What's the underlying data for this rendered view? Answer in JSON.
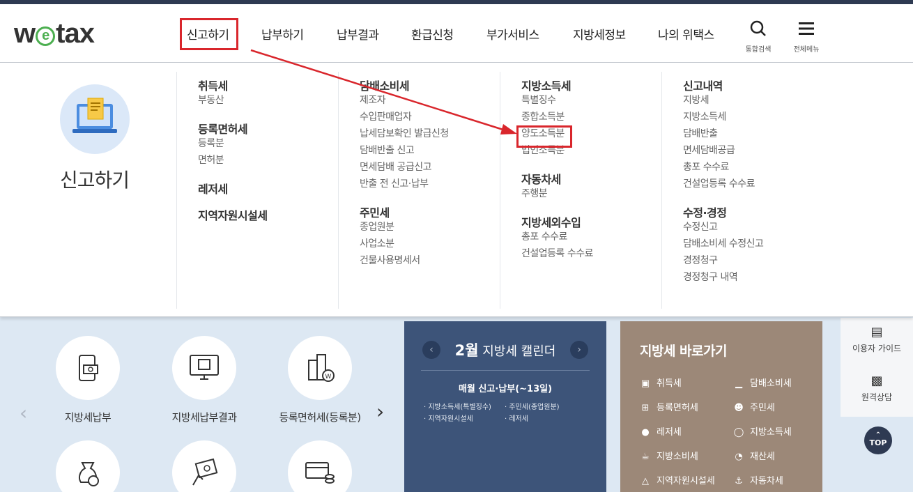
{
  "logo": {
    "text_left": "w",
    "text_e": "e",
    "text_right": "tax"
  },
  "gnb": {
    "items": [
      {
        "label": "신고하기"
      },
      {
        "label": "납부하기"
      },
      {
        "label": "납부결과"
      },
      {
        "label": "환급신청"
      },
      {
        "label": "부가서비스"
      },
      {
        "label": "지방세정보"
      },
      {
        "label": "나의 위택스"
      }
    ],
    "search_label": "통합검색",
    "menu_label": "전체메뉴"
  },
  "mega": {
    "intro_title": "신고하기",
    "col1": {
      "g1": {
        "title": "취득세",
        "items": [
          "부동산"
        ]
      },
      "g2": {
        "title": "등록면허세",
        "items": [
          "등록분",
          "면허분"
        ]
      },
      "g3": {
        "title": "레저세"
      },
      "g4": {
        "title": "지역자원시설세"
      }
    },
    "col2": {
      "g1": {
        "title": "담배소비세",
        "items": [
          "제조자",
          "수입판매업자",
          "납세담보확인 발급신청",
          "담배반출 신고",
          "면세담배 공급신고",
          "반출 전 신고·납부"
        ]
      },
      "g2": {
        "title": "주민세",
        "items": [
          "종업원분",
          "사업소분",
          "건물사용명세서"
        ]
      }
    },
    "col3": {
      "g1": {
        "title": "지방소득세",
        "items": [
          "특별징수",
          "종합소득분",
          "양도소득분",
          "법인소득분"
        ]
      },
      "g2": {
        "title": "자동차세",
        "items": [
          "주행분"
        ]
      },
      "g3": {
        "title": "지방세외수입",
        "items": [
          "총포 수수료",
          "건설업등록 수수료"
        ]
      }
    },
    "col4": {
      "g1": {
        "title": "신고내역",
        "items": [
          "지방세",
          "지방소득세",
          "담배반출",
          "면세담배공급",
          "총포 수수료",
          "건설업등록 수수료"
        ]
      },
      "g2": {
        "title": "수정·경정",
        "items": [
          "수정신고",
          "담배소비세 수정신고",
          "경정청구",
          "경정청구 내역"
        ]
      }
    }
  },
  "services": {
    "items": [
      {
        "label": "지방세납부"
      },
      {
        "label": "지방세납부결과"
      },
      {
        "label": "등록면허세(등록분)"
      }
    ]
  },
  "calendar": {
    "month": "2월",
    "title": "지방세 캘린더",
    "subtitle": "매월 신고·납부(~13일)",
    "items": [
      "지방소득세(특별징수)",
      "주민세(종업원분)",
      "지역자원시설세",
      "레저세"
    ]
  },
  "quick": {
    "title": "지방세 바로가기",
    "items": [
      "취득세",
      "담배소비세",
      "등록면허세",
      "주민세",
      "레저세",
      "지방소득세",
      "지방소비세",
      "재산세",
      "지역자원시설세",
      "자동차세"
    ]
  },
  "side": {
    "guide_label": "이용자 가이드",
    "remote_label": "원격상담",
    "top_label": "TOP"
  },
  "colors": {
    "highlight_red": "#d9262c",
    "calendar_bg": "#3d5479",
    "quick_bg": "#9c8878",
    "content_bg": "#dde8f3",
    "logo_green": "#4caf50"
  }
}
